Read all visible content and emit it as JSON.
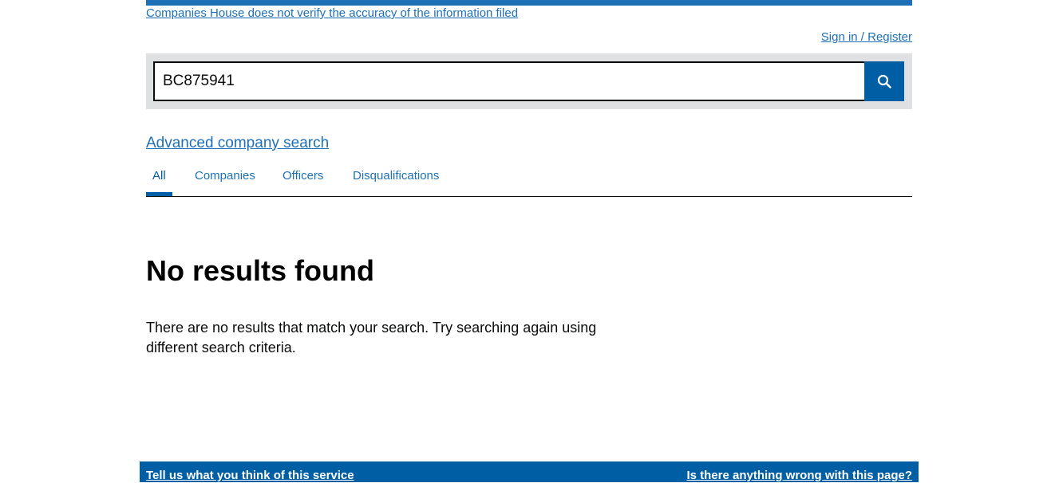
{
  "header": {
    "disclaimer_link": "Companies House does not verify the accuracy of the information filed",
    "signin_link": "Sign in / Register"
  },
  "search": {
    "value": "BC875941",
    "button_icon": "search-icon"
  },
  "advanced_search_link": "Advanced company search",
  "tabs": [
    {
      "label": "All",
      "active": true
    },
    {
      "label": "Companies",
      "active": false
    },
    {
      "label": "Officers",
      "active": false
    },
    {
      "label": "Disqualifications",
      "active": false
    }
  ],
  "results": {
    "heading": "No results found",
    "message": "There are no results that match your search. Try searching again using different search criteria."
  },
  "footer": {
    "feedback_link": "Tell us what you think of this service",
    "report_link": "Is there anything wrong with this page?"
  },
  "colors": {
    "link": "#1d70b8",
    "brand_blue": "#005ea5",
    "search_bg": "#dee0e2",
    "text": "#0b0c0c"
  }
}
